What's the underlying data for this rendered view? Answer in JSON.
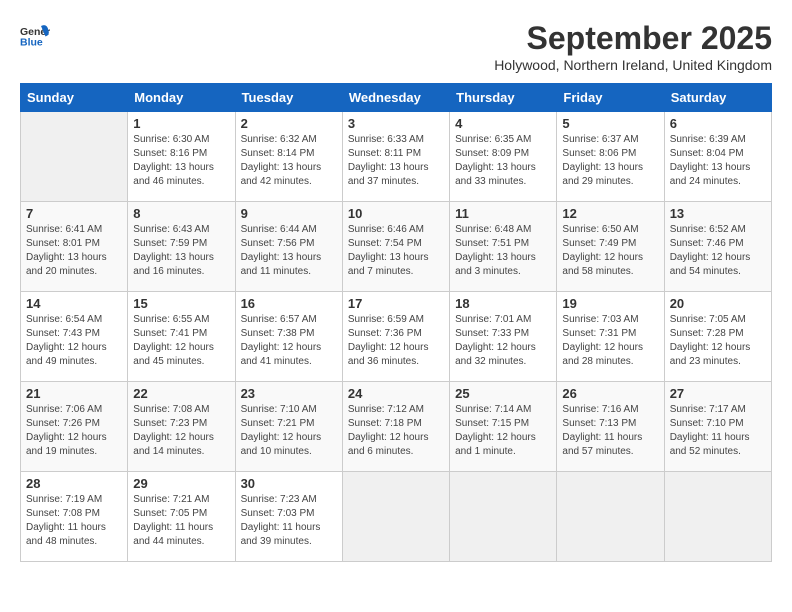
{
  "logo": {
    "general": "General",
    "blue": "Blue"
  },
  "title": "September 2025",
  "location": "Holywood, Northern Ireland, United Kingdom",
  "days_of_week": [
    "Sunday",
    "Monday",
    "Tuesday",
    "Wednesday",
    "Thursday",
    "Friday",
    "Saturday"
  ],
  "weeks": [
    [
      {
        "day": "",
        "info": ""
      },
      {
        "day": "1",
        "info": "Sunrise: 6:30 AM\nSunset: 8:16 PM\nDaylight: 13 hours\nand 46 minutes."
      },
      {
        "day": "2",
        "info": "Sunrise: 6:32 AM\nSunset: 8:14 PM\nDaylight: 13 hours\nand 42 minutes."
      },
      {
        "day": "3",
        "info": "Sunrise: 6:33 AM\nSunset: 8:11 PM\nDaylight: 13 hours\nand 37 minutes."
      },
      {
        "day": "4",
        "info": "Sunrise: 6:35 AM\nSunset: 8:09 PM\nDaylight: 13 hours\nand 33 minutes."
      },
      {
        "day": "5",
        "info": "Sunrise: 6:37 AM\nSunset: 8:06 PM\nDaylight: 13 hours\nand 29 minutes."
      },
      {
        "day": "6",
        "info": "Sunrise: 6:39 AM\nSunset: 8:04 PM\nDaylight: 13 hours\nand 24 minutes."
      }
    ],
    [
      {
        "day": "7",
        "info": "Sunrise: 6:41 AM\nSunset: 8:01 PM\nDaylight: 13 hours\nand 20 minutes."
      },
      {
        "day": "8",
        "info": "Sunrise: 6:43 AM\nSunset: 7:59 PM\nDaylight: 13 hours\nand 16 minutes."
      },
      {
        "day": "9",
        "info": "Sunrise: 6:44 AM\nSunset: 7:56 PM\nDaylight: 13 hours\nand 11 minutes."
      },
      {
        "day": "10",
        "info": "Sunrise: 6:46 AM\nSunset: 7:54 PM\nDaylight: 13 hours\nand 7 minutes."
      },
      {
        "day": "11",
        "info": "Sunrise: 6:48 AM\nSunset: 7:51 PM\nDaylight: 13 hours\nand 3 minutes."
      },
      {
        "day": "12",
        "info": "Sunrise: 6:50 AM\nSunset: 7:49 PM\nDaylight: 12 hours\nand 58 minutes."
      },
      {
        "day": "13",
        "info": "Sunrise: 6:52 AM\nSunset: 7:46 PM\nDaylight: 12 hours\nand 54 minutes."
      }
    ],
    [
      {
        "day": "14",
        "info": "Sunrise: 6:54 AM\nSunset: 7:43 PM\nDaylight: 12 hours\nand 49 minutes."
      },
      {
        "day": "15",
        "info": "Sunrise: 6:55 AM\nSunset: 7:41 PM\nDaylight: 12 hours\nand 45 minutes."
      },
      {
        "day": "16",
        "info": "Sunrise: 6:57 AM\nSunset: 7:38 PM\nDaylight: 12 hours\nand 41 minutes."
      },
      {
        "day": "17",
        "info": "Sunrise: 6:59 AM\nSunset: 7:36 PM\nDaylight: 12 hours\nand 36 minutes."
      },
      {
        "day": "18",
        "info": "Sunrise: 7:01 AM\nSunset: 7:33 PM\nDaylight: 12 hours\nand 32 minutes."
      },
      {
        "day": "19",
        "info": "Sunrise: 7:03 AM\nSunset: 7:31 PM\nDaylight: 12 hours\nand 28 minutes."
      },
      {
        "day": "20",
        "info": "Sunrise: 7:05 AM\nSunset: 7:28 PM\nDaylight: 12 hours\nand 23 minutes."
      }
    ],
    [
      {
        "day": "21",
        "info": "Sunrise: 7:06 AM\nSunset: 7:26 PM\nDaylight: 12 hours\nand 19 minutes."
      },
      {
        "day": "22",
        "info": "Sunrise: 7:08 AM\nSunset: 7:23 PM\nDaylight: 12 hours\nand 14 minutes."
      },
      {
        "day": "23",
        "info": "Sunrise: 7:10 AM\nSunset: 7:21 PM\nDaylight: 12 hours\nand 10 minutes."
      },
      {
        "day": "24",
        "info": "Sunrise: 7:12 AM\nSunset: 7:18 PM\nDaylight: 12 hours\nand 6 minutes."
      },
      {
        "day": "25",
        "info": "Sunrise: 7:14 AM\nSunset: 7:15 PM\nDaylight: 12 hours\nand 1 minute."
      },
      {
        "day": "26",
        "info": "Sunrise: 7:16 AM\nSunset: 7:13 PM\nDaylight: 11 hours\nand 57 minutes."
      },
      {
        "day": "27",
        "info": "Sunrise: 7:17 AM\nSunset: 7:10 PM\nDaylight: 11 hours\nand 52 minutes."
      }
    ],
    [
      {
        "day": "28",
        "info": "Sunrise: 7:19 AM\nSunset: 7:08 PM\nDaylight: 11 hours\nand 48 minutes."
      },
      {
        "day": "29",
        "info": "Sunrise: 7:21 AM\nSunset: 7:05 PM\nDaylight: 11 hours\nand 44 minutes."
      },
      {
        "day": "30",
        "info": "Sunrise: 7:23 AM\nSunset: 7:03 PM\nDaylight: 11 hours\nand 39 minutes."
      },
      {
        "day": "",
        "info": ""
      },
      {
        "day": "",
        "info": ""
      },
      {
        "day": "",
        "info": ""
      },
      {
        "day": "",
        "info": ""
      }
    ]
  ]
}
